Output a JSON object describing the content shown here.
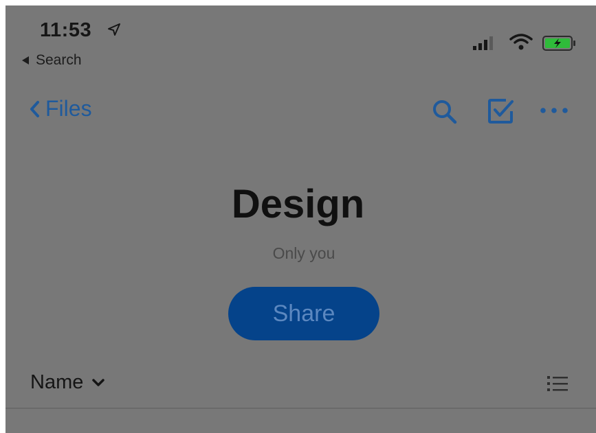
{
  "status_bar": {
    "time": "11:53",
    "back_app_label": "Search",
    "icons": [
      "location-arrow-icon",
      "cellular-signal-icon",
      "wifi-icon",
      "battery-charging-icon"
    ]
  },
  "nav": {
    "back_label": "Files",
    "actions": [
      "search-icon",
      "select-checkbox-icon",
      "more-icon"
    ],
    "accent_color": "#1f5a9c"
  },
  "folder": {
    "title": "Design",
    "sharing_status": "Only you",
    "share_button_label": "Share"
  },
  "sort": {
    "label": "Name",
    "view_toggle_icon": "list-view-icon"
  }
}
